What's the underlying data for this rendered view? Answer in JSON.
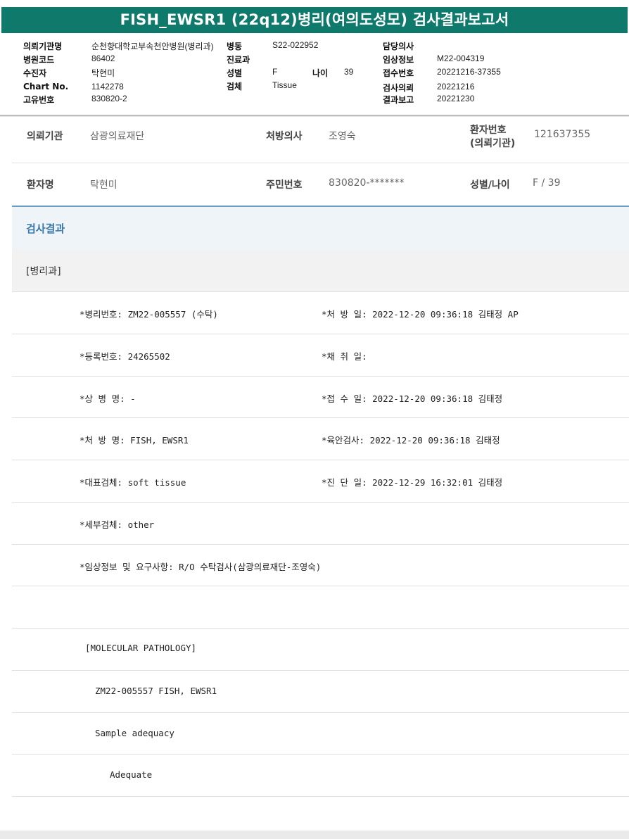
{
  "title": "FISH_EWSR1 (22q12)병리(여의도성모) 검사결과보고서",
  "header": {
    "c1": [
      {
        "label": "의뢰기관명",
        "value": "순천향대학교부속천안병원(병리과)"
      },
      {
        "label": "병원코드",
        "value": "86402"
      },
      {
        "label": "수진자",
        "value": "탁현미"
      },
      {
        "label": "Chart No.",
        "value": "1142278"
      },
      {
        "label": "고유번호",
        "value": "830820-2"
      }
    ],
    "c2": [
      {
        "label": "병동",
        "value": "S22-022952"
      },
      {
        "label": "진료과",
        "value": ""
      },
      {
        "label": "성별",
        "value": "F"
      },
      {
        "label": "검체",
        "value": "Tissue"
      }
    ],
    "age_label": "나이",
    "age_value": "39",
    "c3": [
      {
        "label": "담당의사",
        "value": ""
      },
      {
        "label": "임상정보",
        "value": "M22-004319"
      },
      {
        "label": "접수번호",
        "value": "20221216-37355"
      },
      {
        "label": "검사의뢰",
        "value": "20221216"
      },
      {
        "label": "결과보고",
        "value": "20221230"
      }
    ]
  },
  "info": {
    "r1": {
      "l1": "의뢰기관",
      "v1": "삼광의료재단",
      "l2": "처방의사",
      "v2": "조영숙",
      "l3a": "환자번호",
      "l3b": "(의뢰기관)",
      "v3": "121637355"
    },
    "r2": {
      "l1": "환자명",
      "v1": "탁현미",
      "l2": "주민번호",
      "v2": "830820-*******",
      "l3": "성별/나이",
      "v3": "F / 39"
    }
  },
  "section_title": "검사결과",
  "dept": "[병리과]",
  "results": {
    "left": [
      "*병리번호: ZM22-005557 (수탁)",
      "*등록번호: 24265502",
      "*상 병 명: -",
      "*처 방 명: FISH, EWSR1",
      "*대표검체: soft tissue",
      "*세부검체: other",
      "*임상정보 및 요구사항: R/O 수탁검사(삼광의료재단-조영숙)"
    ],
    "right": [
      "*처 방 일: 2022-12-20 09:36:18  김태정 AP",
      "*채 취 일:",
      "*접 수 일: 2022-12-20 09:36:18  김태정",
      "*육안검사: 2022-12-20 09:36:18  김태정",
      "*진 단 일: 2022-12-29 16:32:01  김태정"
    ]
  },
  "report": [
    "[MOLECULAR PATHOLOGY]",
    "ZM22-005557     FISH, EWSR1",
    "Sample adequacy",
    "Adequate"
  ]
}
